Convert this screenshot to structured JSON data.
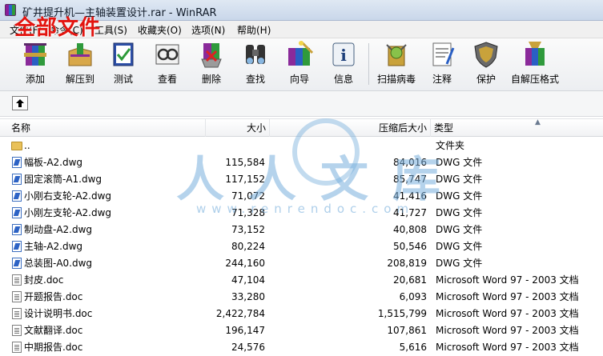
{
  "window": {
    "title": "矿井提升机—主轴装置设计.rar - WinRAR",
    "overlay_label": "全部文件"
  },
  "menu": [
    "文件(F)",
    "命令(C)",
    "工具(S)",
    "收藏夹(O)",
    "选项(N)",
    "帮助(H)"
  ],
  "toolbar": {
    "buttons": [
      {
        "label": "添加",
        "icon": "add-archive-icon"
      },
      {
        "label": "解压到",
        "icon": "extract-to-icon"
      },
      {
        "label": "测试",
        "icon": "test-icon"
      },
      {
        "label": "查看",
        "icon": "view-icon"
      },
      {
        "label": "删除",
        "icon": "delete-icon"
      },
      {
        "label": "查找",
        "icon": "find-icon"
      },
      {
        "label": "向导",
        "icon": "wizard-icon"
      },
      {
        "label": "信息",
        "icon": "info-icon"
      },
      {
        "label": "扫描病毒",
        "icon": "virus-scan-icon"
      },
      {
        "label": "注释",
        "icon": "comment-icon"
      },
      {
        "label": "保护",
        "icon": "protect-icon"
      },
      {
        "label": "自解压格式",
        "icon": "sfx-icon"
      }
    ]
  },
  "columns": {
    "name": "名称",
    "size": "大小",
    "packed": "压缩后大小",
    "type": "类型"
  },
  "files": [
    {
      "name": "..",
      "size": "",
      "packed": "",
      "type": "文件夹",
      "icon": "folder-icon"
    },
    {
      "name": "幅板-A2.dwg",
      "size": "115,584",
      "packed": "84,016",
      "type": "DWG 文件",
      "icon": "dwg-file-icon"
    },
    {
      "name": "固定滚筒-A1.dwg",
      "size": "117,152",
      "packed": "85,747",
      "type": "DWG 文件",
      "icon": "dwg-file-icon"
    },
    {
      "name": "小刚右支轮-A2.dwg",
      "size": "71,072",
      "packed": "41,416",
      "type": "DWG 文件",
      "icon": "dwg-file-icon"
    },
    {
      "name": "小刚左支轮-A2.dwg",
      "size": "71,328",
      "packed": "41,727",
      "type": "DWG 文件",
      "icon": "dwg-file-icon"
    },
    {
      "name": "制动盘-A2.dwg",
      "size": "73,152",
      "packed": "40,808",
      "type": "DWG 文件",
      "icon": "dwg-file-icon"
    },
    {
      "name": "主轴-A2.dwg",
      "size": "80,224",
      "packed": "50,546",
      "type": "DWG 文件",
      "icon": "dwg-file-icon"
    },
    {
      "name": "总装图-A0.dwg",
      "size": "244,160",
      "packed": "208,819",
      "type": "DWG 文件",
      "icon": "dwg-file-icon"
    },
    {
      "name": "封皮.doc",
      "size": "47,104",
      "packed": "20,681",
      "type": "Microsoft Word 97 - 2003 文档",
      "icon": "doc-file-icon"
    },
    {
      "name": "开题报告.doc",
      "size": "33,280",
      "packed": "6,093",
      "type": "Microsoft Word 97 - 2003 文档",
      "icon": "doc-file-icon"
    },
    {
      "name": "设计说明书.doc",
      "size": "2,422,784",
      "packed": "1,515,799",
      "type": "Microsoft Word 97 - 2003 文档",
      "icon": "doc-file-icon"
    },
    {
      "name": "文献翻译.doc",
      "size": "196,147",
      "packed": "107,861",
      "type": "Microsoft Word 97 - 2003 文档",
      "icon": "doc-file-icon"
    },
    {
      "name": "中期报告.doc",
      "size": "24,576",
      "packed": "5,616",
      "type": "Microsoft Word 97 - 2003 文档",
      "icon": "doc-file-icon"
    }
  ],
  "watermark": {
    "text": "人人文库",
    "url": "www.renrendoc.com"
  },
  "colors": {
    "overlay_red": "#e3140f",
    "watermark_blue": "#78afdc"
  }
}
